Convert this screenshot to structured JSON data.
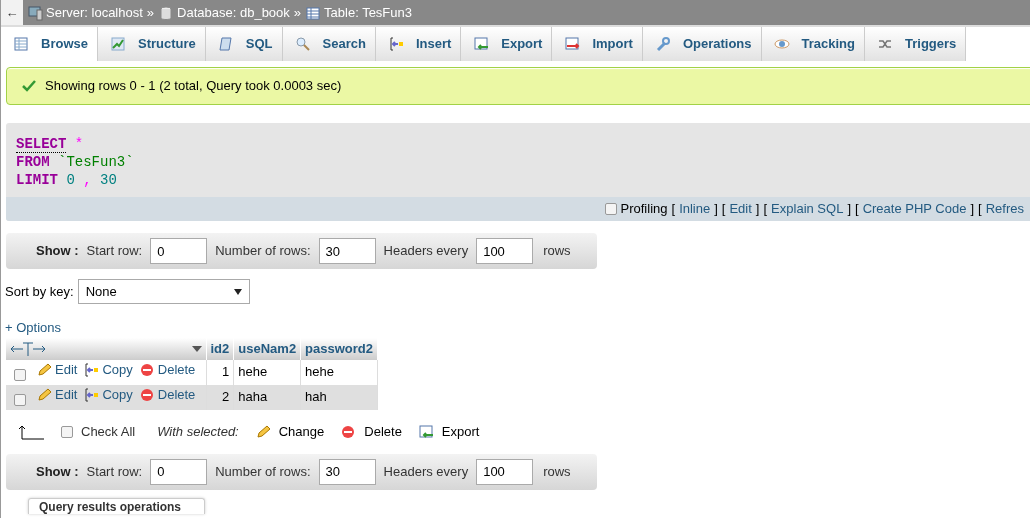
{
  "breadcrumb": {
    "back": "←",
    "separator": "»",
    "items": [
      {
        "kind": "server",
        "text": "Server: localhost"
      },
      {
        "kind": "database",
        "text": "Database: db_book"
      },
      {
        "kind": "table",
        "text": "Table: TesFun3"
      }
    ]
  },
  "tabs": [
    {
      "kind": "browse",
      "label": "Browse",
      "selected": true
    },
    {
      "kind": "structure",
      "label": "Structure",
      "selected": false
    },
    {
      "kind": "sql",
      "label": "SQL",
      "selected": false
    },
    {
      "kind": "search",
      "label": "Search",
      "selected": false
    },
    {
      "kind": "insert",
      "label": "Insert",
      "selected": false
    },
    {
      "kind": "export",
      "label": "Export",
      "selected": false
    },
    {
      "kind": "import",
      "label": "Import",
      "selected": false
    },
    {
      "kind": "operations",
      "label": "Operations",
      "selected": false
    },
    {
      "kind": "tracking",
      "label": "Tracking",
      "selected": false
    },
    {
      "kind": "triggers",
      "label": "Triggers",
      "selected": false
    }
  ],
  "message": {
    "text": "Showing rows 0 - 1 (2 total, Query took 0.0003 sec)"
  },
  "sql": {
    "lines": [
      [
        {
          "kind": "keyword",
          "text": "SELECT"
        },
        {
          "kind": "operator",
          "text": "*"
        }
      ],
      [
        {
          "kind": "keyword",
          "text": "FROM"
        },
        {
          "kind": "identifier",
          "text": "`TesFun3`"
        }
      ],
      [
        {
          "kind": "keyword",
          "text": "LIMIT"
        },
        {
          "kind": "number",
          "text": "0"
        },
        {
          "kind": "operator",
          "text": ","
        },
        {
          "kind": "number",
          "text": "30"
        }
      ]
    ],
    "profiling": {
      "label": "Profiling",
      "checked": false
    },
    "bracket_open": "[",
    "bracket_close": "]",
    "links": [
      "Inline",
      "Edit",
      "Explain SQL",
      "Create PHP Code",
      "Refres"
    ]
  },
  "nav_top": {
    "title": "Show :",
    "start_label": "Start row:",
    "start_value": "0",
    "rows_label": "Number of rows:",
    "rows_value": "30",
    "headers_label": "Headers every",
    "headers_value": "100",
    "suffix": "rows"
  },
  "sort": {
    "label": "Sort by key:",
    "value": "None"
  },
  "options_link": "+ Options",
  "table": {
    "columns": [
      "id2",
      "useNam2",
      "password2"
    ],
    "rows": [
      {
        "selected": false,
        "actions": [
          {
            "kind": "edit",
            "label": "Edit"
          },
          {
            "kind": "copy",
            "label": "Copy"
          },
          {
            "kind": "delete",
            "label": "Delete"
          }
        ],
        "cells": [
          "1",
          "hehe",
          "hehe"
        ]
      },
      {
        "selected": false,
        "actions": [
          {
            "kind": "edit",
            "label": "Edit"
          },
          {
            "kind": "copy",
            "label": "Copy"
          },
          {
            "kind": "delete",
            "label": "Delete"
          }
        ],
        "cells": [
          "2",
          "haha",
          "hah"
        ]
      }
    ]
  },
  "bulk": {
    "check_all": "Check All",
    "checked": false,
    "with_selected": "With selected:",
    "actions": [
      {
        "kind": "edit",
        "label": "Change"
      },
      {
        "kind": "delete",
        "label": "Delete"
      },
      {
        "kind": "export",
        "label": "Export"
      }
    ]
  },
  "nav_bottom": {
    "title": "Show :",
    "start_label": "Start row:",
    "start_value": "0",
    "rows_label": "Number of rows:",
    "rows_value": "30",
    "headers_label": "Headers every",
    "headers_value": "100",
    "suffix": "rows"
  },
  "footer_tab": "Query results operations"
}
